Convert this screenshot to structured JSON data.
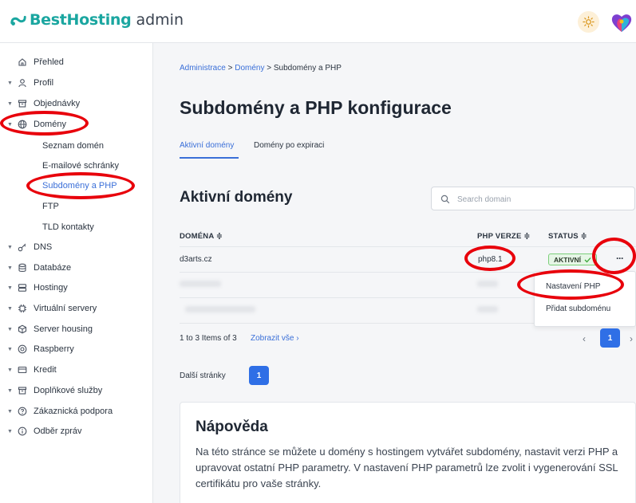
{
  "header": {
    "brand": "BestHosting",
    "brand_suffix": "admin",
    "theme_icon": "sun-icon",
    "avatar_icon": "heart-avatar-icon"
  },
  "sidebar": {
    "items": [
      {
        "label": "Přehled",
        "icon": "home-icon"
      },
      {
        "label": "Profil",
        "icon": "user-icon"
      },
      {
        "label": "Objednávky",
        "icon": "box-icon"
      },
      {
        "label": "Domény",
        "icon": "globe-icon"
      },
      {
        "label": "DNS",
        "icon": "key-icon"
      },
      {
        "label": "Databáze",
        "icon": "database-icon"
      },
      {
        "label": "Hostingy",
        "icon": "server-icon"
      },
      {
        "label": "Virtuální servery",
        "icon": "cpu-icon"
      },
      {
        "label": "Server housing",
        "icon": "cube-icon"
      },
      {
        "label": "Raspberry",
        "icon": "target-icon"
      },
      {
        "label": "Kredit",
        "icon": "card-icon"
      },
      {
        "label": "Doplňkové služby",
        "icon": "box-icon"
      },
      {
        "label": "Zákaznická podpora",
        "icon": "help-icon"
      },
      {
        "label": "Odběr zpráv",
        "icon": "info-icon"
      }
    ],
    "domains_sub": [
      {
        "label": "Seznam domén"
      },
      {
        "label": "E-mailové schránky"
      },
      {
        "label": "Subdomény a PHP"
      },
      {
        "label": "FTP"
      },
      {
        "label": "TLD kontakty"
      }
    ]
  },
  "breadcrumb": {
    "part1": "Administrace",
    "sep1": " > ",
    "part2": "Domény",
    "sep2": " > ",
    "part3": "Subdomény a PHP"
  },
  "page_title": "Subdomény a PHP konfigurace",
  "tabs": [
    {
      "label": "Aktivní domény"
    },
    {
      "label": "Domény po expiraci"
    }
  ],
  "section_title": "Aktivní domény",
  "search": {
    "placeholder": "Search domain"
  },
  "table": {
    "headers": [
      "DOMÉNA ≑",
      "PHP VERZE ≑",
      "STATUS ≑"
    ],
    "rows": [
      {
        "domain": "d3arts.cz",
        "php": "php8.1",
        "status": "AKTIVNÍ"
      }
    ],
    "more_label": "···"
  },
  "dropdown": {
    "options": [
      "Nastavení PHP",
      "Přidat subdoménu"
    ]
  },
  "pagination": {
    "info": "1 to 3 Items of 3",
    "show_all": "Zobrazit vše",
    "show_all_arrow": "›",
    "prev": "‹",
    "current": "1",
    "next": "›"
  },
  "next_pages": {
    "label": "Další stránky",
    "page": "1"
  },
  "help": {
    "title": "Nápověda",
    "text": "Na této stránce se můžete u domény s hostingem vytvářet subdomény, nastavit verzi PHP a upravovat ostatní PHP parametry. V nastavení PHP parametrů lze zvolit i vygenerování SSL certifikátu pro vaše stránky."
  },
  "colors": {
    "accent": "#3a6fd8",
    "brand": "#1aa6a0",
    "active_badge": "#e6f6e6",
    "annotation_red": "#e8000b"
  }
}
